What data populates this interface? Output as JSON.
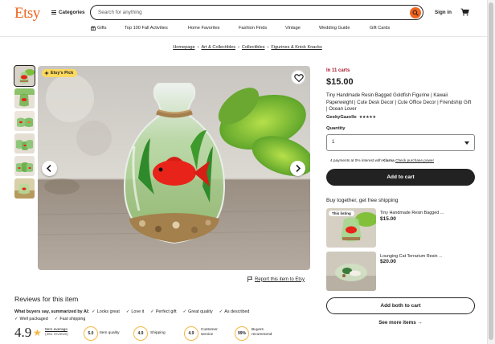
{
  "header": {
    "logo": "Etsy",
    "categories_label": "Categories",
    "search_placeholder": "Search for anything",
    "sign_in": "Sign in"
  },
  "nav": [
    {
      "label": "Gifts",
      "icon": "gift-icon"
    },
    {
      "label": "Top 100 Fall Activities"
    },
    {
      "label": "Home Favorites"
    },
    {
      "label": "Fashion Finds"
    },
    {
      "label": "Vintage"
    },
    {
      "label": "Wedding Guide"
    },
    {
      "label": "Gift Cards"
    }
  ],
  "breadcrumb": [
    "Homepage",
    "Art & Collectibles",
    "Collectibles",
    "Figurines & Knick Knacks"
  ],
  "gallery": {
    "badge": "Etsy's Pick",
    "report_link": "Report this item to Etsy",
    "thumbnail_count": 6
  },
  "reviews": {
    "title": "Reviews for this item",
    "summary_label": "What buyers say, summarized by AI:",
    "highlights": [
      "Looks great",
      "Love it",
      "Perfect gift",
      "Great quality",
      "As described",
      "Well packaged",
      "Fast shipping"
    ],
    "overall": "4.9",
    "item_average_label": "Item average",
    "review_count": "(461 reviews)",
    "metrics": [
      {
        "value": "5.0",
        "label": "Item quality"
      },
      {
        "value": "4.9",
        "label": "Shipping"
      },
      {
        "value": "4.9",
        "label": "Customer service"
      },
      {
        "value": "99%",
        "label": "Buyers recommend"
      }
    ]
  },
  "listing": {
    "in_carts": "In 11 carts",
    "price": "$15.00",
    "title": "Tiny Handmade Resin Bagged Goldfish Figurine | Kawaii Paperweight | Cute Desk Decor | Cute Office Decor | Friendship Gift | Ocean Lover",
    "shop": "GeekyGazelle",
    "stars": "★★★★★",
    "quantity_label": "Quantity",
    "quantity_value": "1",
    "klarna_prefix": "4 payments at 0% interest with",
    "klarna_brand": "Klarna",
    "klarna_link": "Check purchase power",
    "add_to_cart": "Add to cart"
  },
  "bundle": {
    "title": "Buy together, get free shipping",
    "items": [
      {
        "badge": "This listing",
        "name": "Tiny Handmade Resin Bagged ...",
        "price": "$15.00"
      },
      {
        "name": "Lounging Cat Terrarium Resin ...",
        "price": "$20.00"
      }
    ],
    "add_both": "Add both to cart",
    "see_more": "See more items"
  },
  "colors": {
    "brand": "#f1641e",
    "badge": "#fdd95c",
    "urgency": "#a61a2e",
    "button_dark": "#222222"
  }
}
